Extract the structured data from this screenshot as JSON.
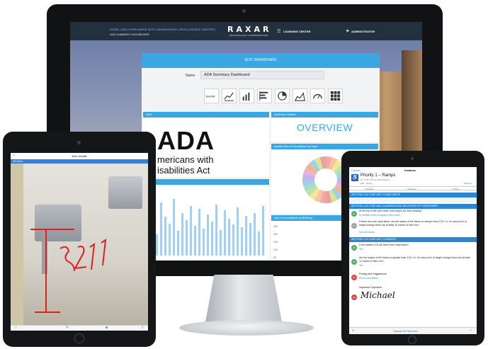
{
  "dashboard": {
    "breadcrumb": "HOME | ADA COMPLIANCE WITH DASHBOARDS | INTELLIGENCE CENTER |",
    "subtitle": "ADA SUMMARY DASHBOARD",
    "logo": "RAXAR",
    "logo_sub": "TECHNOLOGY CORPORATION",
    "nav_learning": "LEARNING CENTER",
    "nav_admin": "ADMINISTRATOR",
    "edit_title": "EDIT DASHBOARD",
    "name_label": "Name",
    "name_value": "ADA Summary Dashboard",
    "widget_icons": [
      "raxar-logo-icon",
      "line-chart-icon",
      "bar-chart-icon",
      "horizontal-bar-icon",
      "pie-chart-icon",
      "area-chart-icon",
      "gauge-icon",
      "grid-icon"
    ],
    "cards": {
      "ada": {
        "title": "ADA",
        "big": "ADA",
        "line1": "mericans with",
        "line2": "isabilities Act"
      },
      "overview": {
        "title": "Overview Header",
        "text": "OVERVIEW"
      },
      "assets": {
        "title": "Assets Out of Compliance by Type"
      },
      "building": {
        "title": "Out of Compliance by Building",
        "y_ticks": [
          "250",
          "200",
          "150",
          "100",
          "50"
        ]
      },
      "ding": {
        "title": "ding"
      }
    }
  },
  "ipad_left": {
    "title": "Item Details",
    "details": "DETAILS",
    "back": "<"
  },
  "ipad_right": {
    "cancel": "Cancel",
    "title": "Instance",
    "priority": "Priority 1 – Ramps",
    "meta": "ID: 1745 | Priority Park Building",
    "edit": "Edit",
    "delete": "Delete",
    "release": "Release",
    "tabs": [
      "Checklist",
      "Attributes",
      "Photos"
    ],
    "sections": [
      "SECTION 1.34 CODE 405.2 CLEAR WIDTH",
      "SECTION 1.22 CODE 406.2 LANDINGS AND 406.3 SIDES OF CURB RAMPS",
      "SECTION 1.24 CODE 405.7 LANDINGS"
    ],
    "questions": [
      {
        "q": "At the top of the curb ramp, how long is the level landing?",
        "a": "A) Greater than or equal to 36 inches",
        "badge": "20"
      },
      {
        "q": "If there are curb ramp flares, are the slopes of the flares no steeper than 1/10, i.e. for every inch of height change there are at least 10 inches of flare run?",
        "a": "No curb flares",
        "badge": "20"
      },
      {
        "q": "If the answer is B are there curb ramp flares?",
        "a": "Yes",
        "badge": "20"
      },
      {
        "q": "Are the slopes of the flares no greater than 1/12, i.e. for every inch of height change there are at least 12 inches of flare run?",
        "a": "Yes",
        "badge": "20"
      },
      {
        "q": "Finding and Suggestions",
        "a": "Put in curb flares",
        "badge": "20"
      },
      {
        "q": "Inspectors Signature",
        "a": "Michael",
        "badge": "20"
      }
    ],
    "footer": "Update All Statuses"
  },
  "colors": {
    "accent": "#3aa7e2",
    "topbar": "#23303f",
    "bezel": "#151617"
  }
}
